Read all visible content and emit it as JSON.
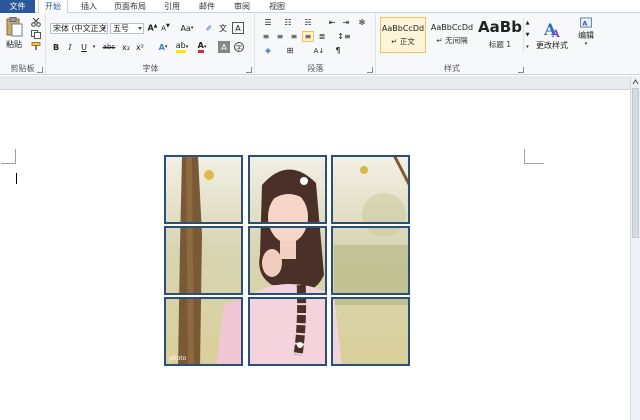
{
  "tabs": {
    "file": "文件",
    "items": [
      "开始",
      "插入",
      "页面布局",
      "引用",
      "邮件",
      "审阅",
      "视图"
    ],
    "active": "开始"
  },
  "clipboard": {
    "paste": "粘贴",
    "group": "剪贴板"
  },
  "font": {
    "name": "宋体 (中文正文)",
    "size": "五号",
    "group": "字体",
    "buttons": [
      "B",
      "I",
      "U",
      "abc",
      "x₂",
      "x²",
      "A",
      "A",
      "Aa"
    ]
  },
  "paragraph": {
    "group": "段落"
  },
  "styles": {
    "group": "样式",
    "items": [
      {
        "sample": "AaBbCcDd",
        "name": "正文",
        "selected": true
      },
      {
        "sample": "AaBbCcDd",
        "name": "无间隔",
        "selected": false
      },
      {
        "sample": "AaBb",
        "name": "标题 1",
        "selected": false
      }
    ],
    "change": "更改样式",
    "edit": "编辑"
  },
  "photo": {
    "watermark": "photo"
  },
  "colors": {
    "accent": "#2b579a",
    "tile_border": "#2b4f7c",
    "highlight": "#f2c15c",
    "font_red": "#d03030"
  }
}
